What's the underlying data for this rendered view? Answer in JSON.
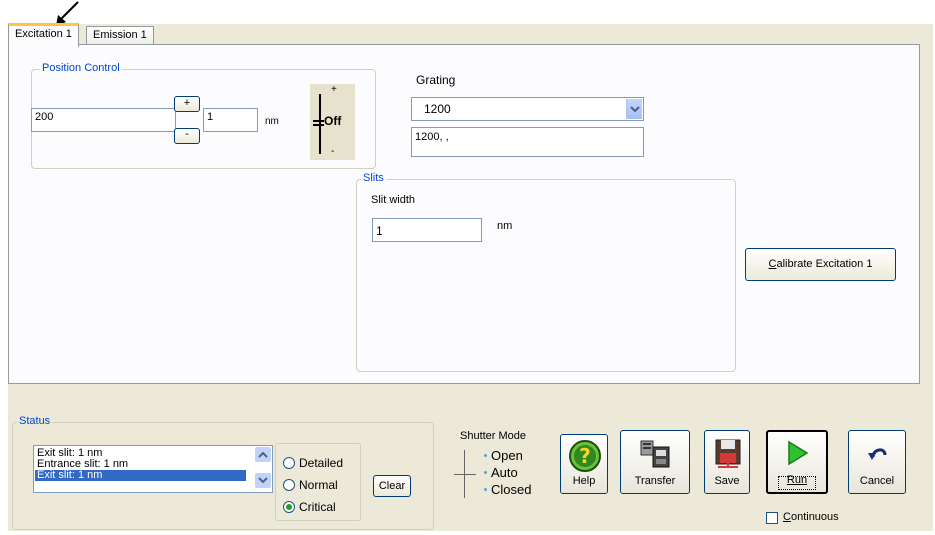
{
  "tabs": [
    {
      "label": "Excitation 1",
      "active": true
    },
    {
      "label": "Emission 1",
      "active": false
    }
  ],
  "position_control": {
    "title": "Position Control",
    "position_value": "200",
    "step_value": "1",
    "unit": "nm",
    "plus_label": "+",
    "minus_label": "-",
    "switch_plus": "+",
    "switch_state": "Off",
    "switch_minus": "-"
  },
  "grating": {
    "label": "Grating",
    "selected": "1200",
    "info": "1200, ,"
  },
  "slits": {
    "title": "Slits",
    "width_label": "Slit width",
    "width_value": "1",
    "unit": "nm"
  },
  "calibrate_button": {
    "prefix": "C",
    "rest": "alibrate Excitation 1"
  },
  "status": {
    "title": "Status",
    "lines": [
      "Exit slit: 1 nm",
      "Entrance slit: 1 nm",
      "Exit slit: 1 nm"
    ],
    "selected_index": 2,
    "detail_options": [
      "Detailed",
      "Normal",
      "Critical"
    ],
    "detail_selected": "Critical",
    "clear_label": "Clear"
  },
  "shutter": {
    "label": "Shutter Mode",
    "options": [
      "Open",
      "Auto",
      "Closed"
    ]
  },
  "actions": {
    "help": "Help",
    "transfer": "Transfer",
    "save": "Save",
    "run": "Run",
    "cancel": "Cancel"
  },
  "continuous": {
    "prefix": "C",
    "rest": "ontinuous",
    "checked": false
  },
  "colors": {
    "group_title": "#0046d5",
    "selection": "#316ac5",
    "tab_highlight": "#ffc83c",
    "run_icon": "#2fc22f"
  }
}
